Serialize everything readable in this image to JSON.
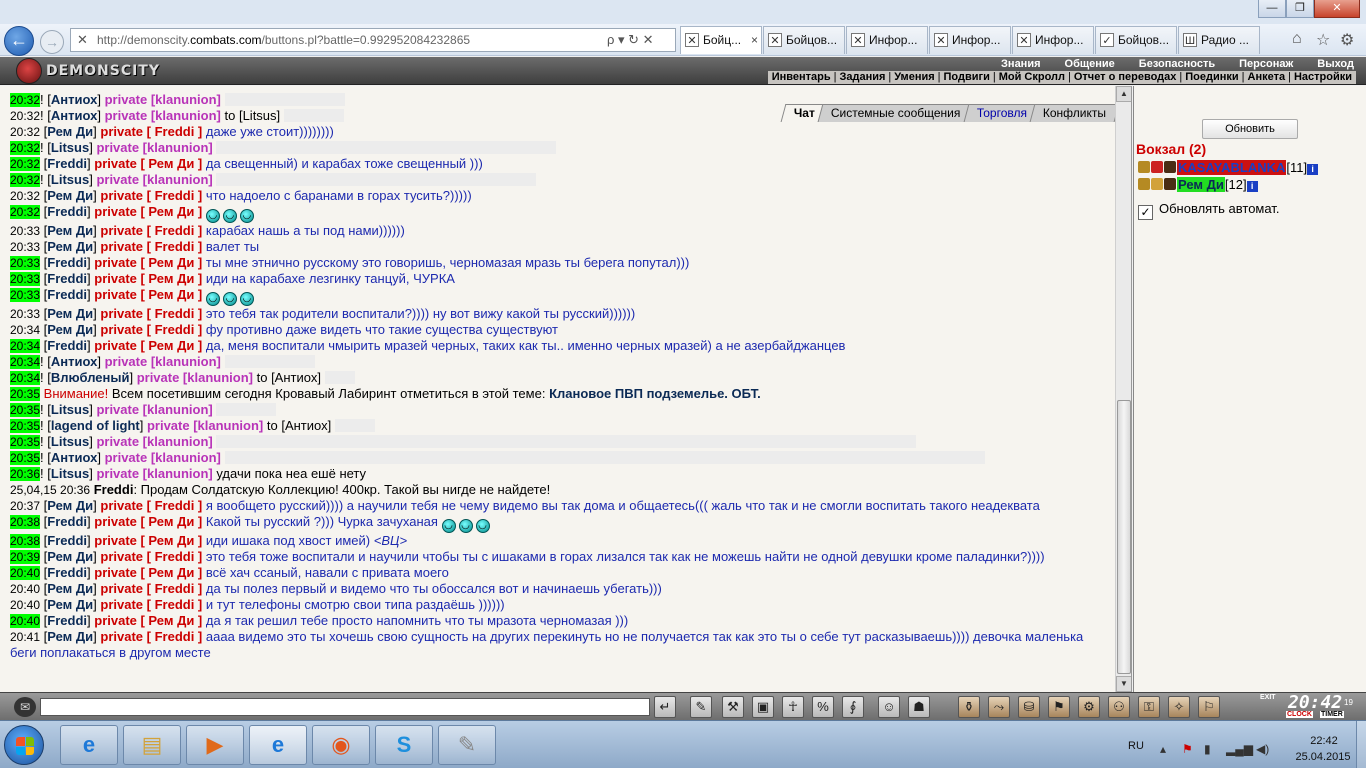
{
  "window": {
    "minimize": "—",
    "maximize": "❐",
    "close": "✕"
  },
  "browser": {
    "back": "←",
    "forward": "→",
    "url_prefix": "http://demonscity.",
    "url_host": "combats.com",
    "url_path": "/buttons.pl?battle=0.992952084232865",
    "address_tools": "ρ ▾ ↻ ✕",
    "tabs": [
      {
        "label": "Бойц...",
        "icon": "✕",
        "active": true
      },
      {
        "label": "Бойцов...",
        "icon": "✕"
      },
      {
        "label": "Инфор...",
        "icon": "✕"
      },
      {
        "label": "Инфор...",
        "icon": "✕"
      },
      {
        "label": "Инфор...",
        "icon": "✕"
      },
      {
        "label": "Бойцов...",
        "icon": "✓"
      },
      {
        "label": "Радио ...",
        "icon": "Ш"
      }
    ],
    "tools": [
      "⌂",
      "☆",
      "⚙"
    ]
  },
  "game": {
    "logo": "DEMONSCITY",
    "top_menu": [
      "Знания",
      "Общение",
      "Безопасность",
      "Персонаж",
      "Выход"
    ],
    "sub_menu": [
      "Инвентарь",
      "Задания",
      "Умения",
      "Подвиги",
      "Мой Скролл",
      "Отчет о переводах",
      "Поединки",
      "Анкета",
      "Настройки"
    ]
  },
  "chat_tabs": [
    {
      "label": "Чат",
      "active": true
    },
    {
      "label": "Системные сообщения"
    },
    {
      "label": "Торговля",
      "blue": true
    },
    {
      "label": "Конфликты"
    }
  ],
  "chat": [
    {
      "ts": "20:32",
      "hl": true,
      "excl": true,
      "nick": "Антиох",
      "priv": "private [klanunion]",
      "clan": true,
      "msg": "",
      "redact": 120
    },
    {
      "ts": "20:32",
      "hl": false,
      "excl": true,
      "nick": "Антиох",
      "priv": "private [klanunion]",
      "clan": true,
      "msg": "to [Litsus]",
      "redact": 60
    },
    {
      "ts": "20:32",
      "hl": false,
      "nick": "Рем Ди",
      "priv": "private [ Freddi ]",
      "msg": "даже уже стоит))))))))"
    },
    {
      "ts": "20:32",
      "hl": true,
      "excl": true,
      "nick": "Litsus",
      "priv": "private [klanunion]",
      "clan": true,
      "msg": "",
      "redact": 340
    },
    {
      "ts": "20:32",
      "hl": true,
      "nick": "Freddi",
      "priv": "private [ Рем Ди ]",
      "msg": "да свещенный) и карабах тоже свещенный )))"
    },
    {
      "ts": "20:32",
      "hl": true,
      "excl": true,
      "nick": "Litsus",
      "priv": "private [klanunion]",
      "clan": true,
      "msg": "",
      "redact": 320
    },
    {
      "ts": "20:32",
      "hl": false,
      "nick": "Рем Ди",
      "priv": "private [ Freddi ]",
      "msg": "что надоело с баранами в горах тусить?)))))"
    },
    {
      "ts": "20:32",
      "hl": true,
      "nick": "Freddi",
      "priv": "private [ Рем Ди ]",
      "msg": "",
      "smiles": 3
    },
    {
      "ts": "20:33",
      "hl": false,
      "nick": "Рем Ди",
      "priv": "private [ Freddi ]",
      "msg": "карабах нашь а ты под нами))))))"
    },
    {
      "ts": "20:33",
      "hl": false,
      "nick": "Рем Ди",
      "priv": "private [ Freddi ]",
      "msg": "валет ты"
    },
    {
      "ts": "20:33",
      "hl": true,
      "nick": "Freddi",
      "priv": "private [ Рем Ди ]",
      "msg": "ты мне этнично русскому это говоришь, черномазая мразь ты берега попутал)))"
    },
    {
      "ts": "20:33",
      "hl": true,
      "nick": "Freddi",
      "priv": "private [ Рем Ди ]",
      "msg": "иди на карабахе лезгинку танцуй, ЧУРКА"
    },
    {
      "ts": "20:33",
      "hl": true,
      "nick": "Freddi",
      "priv": "private [ Рем Ди ]",
      "msg": "",
      "smiles": 3
    },
    {
      "ts": "20:33",
      "hl": false,
      "nick": "Рем Ди",
      "priv": "private [ Freddi ]",
      "msg": "это тебя так родители воспитали?)))) ну вот вижу какой ты русский))))))"
    },
    {
      "ts": "20:34",
      "hl": false,
      "nick": "Рем Ди",
      "priv": "private [ Freddi ]",
      "msg": "фу противно даже видеть что такие существа существуют"
    },
    {
      "ts": "20:34",
      "hl": true,
      "nick": "Freddi",
      "priv": "private [ Рем Ди ]",
      "msg": "да, меня воспитали чмырить мразей черных, таких как ты.. именно черных мразей) а не азербайджанцев"
    },
    {
      "ts": "20:34",
      "hl": true,
      "excl": true,
      "nick": "Антиох",
      "priv": "private [klanunion]",
      "clan": true,
      "msg": "",
      "redact": 90
    },
    {
      "ts": "20:34",
      "hl": true,
      "excl": true,
      "nick": "Влюбленый",
      "priv": "private [klanunion]",
      "clan": true,
      "msg": "to [Антиох]",
      "redact": 30
    },
    {
      "ts": "20:35",
      "hl": true,
      "system": true,
      "label": "Внимание!",
      "msg": "Всем посетившим сегодня Кровавый Лабиринт отметиться в этой теме:",
      "bold_msg": "Клановое ПВП подземелье. ОБТ."
    },
    {
      "ts": "20:35",
      "hl": true,
      "excl": true,
      "nick": "Litsus",
      "priv": "private [klanunion]",
      "clan": true,
      "msg": "",
      "redact": 60
    },
    {
      "ts": "20:35",
      "hl": true,
      "excl": true,
      "nick": "lagend of light",
      "priv": "private [klanunion]",
      "clan": true,
      "msg": "to [Антиох]",
      "redact": 40
    },
    {
      "ts": "20:35",
      "hl": true,
      "excl": true,
      "nick": "Litsus",
      "priv": "private [klanunion]",
      "clan": true,
      "msg": "",
      "redact": 700
    },
    {
      "ts": "20:35",
      "hl": true,
      "excl": true,
      "nick": "Антиох",
      "priv": "private [klanunion]",
      "clan": true,
      "msg": "",
      "redact": 760
    },
    {
      "ts": "20:36",
      "hl": true,
      "excl": true,
      "nick": "Litsus",
      "priv": "private [klanunion]",
      "clan": true,
      "msg": "удачи пока неа ешё нету",
      "blk": true
    },
    {
      "ts": "25,04,15 20:36",
      "hl": false,
      "trade": true,
      "nick": "Freddi",
      "msg": "Продам Солдатскую Коллекцию! 400кр. Такой вы нигде не найдете!"
    },
    {
      "ts": "20:37",
      "hl": false,
      "nick": "Рем Ди",
      "priv": "private [ Freddi ]",
      "msg": "я вообщето русский)))) а научили тебя не чему видемо вы так дома и общаетесь((( жаль что так и не смогли воспитать такого неадеквата",
      "wrap": true
    },
    {
      "ts": "20:38",
      "hl": true,
      "nick": "Freddi",
      "priv": "private [ Рем Ди ]",
      "msg": "Какой ты русский ?))) Чурка зачуханая",
      "smiles": 3
    },
    {
      "ts": "20:38",
      "hl": true,
      "nick": "Freddi",
      "priv": "private [ Рем Ди ]",
      "msg": "иди ишака под хвост имей)",
      "tail": "<ВЦ>"
    },
    {
      "ts": "20:39",
      "hl": true,
      "nick": "Рем Ди",
      "priv": "private [ Freddi ]",
      "msg": "это тебя тоже воспитали и научили чтобы ты с ишаками в горах лизался так как не можешь найти не одной девушки кроме паладинки?))))",
      "wrap": true
    },
    {
      "ts": "20:40",
      "hl": true,
      "nick": "Freddi",
      "priv": "private [ Рем Ди ]",
      "msg": "всё хач ссаный, навали с привата моего"
    },
    {
      "ts": "20:40",
      "hl": false,
      "nick": "Рем Ди",
      "priv": "private [ Freddi ]",
      "msg": "да ты полез первый и видемо что ты обоссался вот и начинаешь убегать)))"
    },
    {
      "ts": "20:40",
      "hl": false,
      "nick": "Рем Ди",
      "priv": "private [ Freddi ]",
      "msg": "и тут телефоны смотрю свои типа раздаёшь ))))))"
    },
    {
      "ts": "20:40",
      "hl": true,
      "nick": "Freddi",
      "priv": "private [ Рем Ди ]",
      "msg": "да я так решил тебе просто напомнить что ты мразота черномазая )))"
    },
    {
      "ts": "20:41",
      "hl": false,
      "nick": "Рем Ди",
      "priv": "private [ Freddi ]",
      "msg": "аааа видемо это ты хочешь свою сущность на других перекинуть но не получается так как это ты о себе тут расказываешь)))) девочка маленька беги поплакаться в другом месте",
      "wrap": true
    }
  ],
  "right_panel": {
    "refresh_label": "Обновить",
    "location": "Вокзал (2)",
    "players": [
      {
        "name": "KASAYABLANKA",
        "level": "[11]",
        "name_bg": "#cc1111",
        "name_color": "#1a3fc4",
        "info": "i"
      },
      {
        "name": "Рем Ди",
        "level": "[12]",
        "name_bg": "#22dd22",
        "name_color": "#0b2a55",
        "info": "i"
      }
    ],
    "auto_check": "✓",
    "auto_label": "Обновлять автомат."
  },
  "bottom_bar": {
    "buttons": [
      "↵",
      "✎",
      "⚒",
      "▣",
      "☥",
      "%",
      "∮",
      "☺",
      "☗",
      "⚱",
      "⤳",
      "⛁",
      "⚑",
      "⚙",
      "⚇",
      "⚿",
      "✧",
      "⚐"
    ],
    "exit": "EXIT",
    "clock_time": "20:42",
    "clock_sec": "19",
    "clock_label": "CLOCK",
    "timer_label": "TIMER"
  },
  "taskbar": {
    "apps": [
      "e",
      "▤",
      "▶",
      "e",
      "◉",
      "S",
      "✎"
    ],
    "lang": "RU",
    "time": "22:42",
    "date": "25.04.2015"
  }
}
